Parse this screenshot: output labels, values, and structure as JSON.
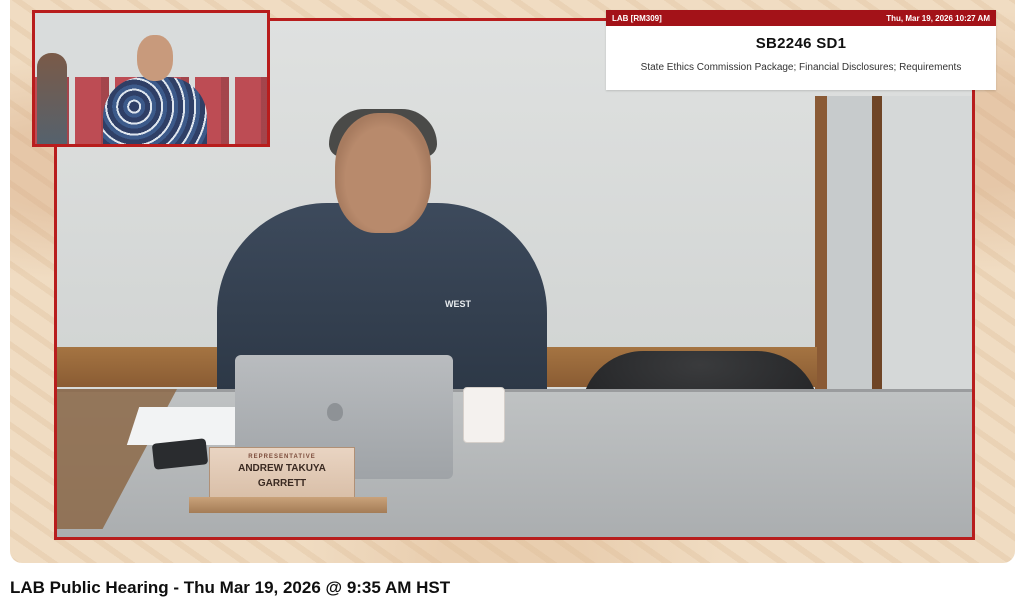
{
  "overlay": {
    "room": "LAB [RM309]",
    "datetime": "Thu, Mar 19, 2026 10:27 AM",
    "bill": "SB2246 SD1",
    "description": "State Ethics Commission Package; Financial Disclosures; Requirements"
  },
  "nameplate": {
    "role": "REPRESENTATIVE",
    "name_line1": "ANDREW TAKUYA",
    "name_line2": "GARRETT"
  },
  "scene": {
    "jacket_logo": "WEST"
  },
  "video": {
    "title": "LAB Public Hearing - Thu Mar 19, 2026 @ 9:35 AM HST"
  },
  "colors": {
    "accent_red": "#a31218",
    "frame_red": "#b81d1d",
    "background_beige": "#f0dcc2"
  }
}
